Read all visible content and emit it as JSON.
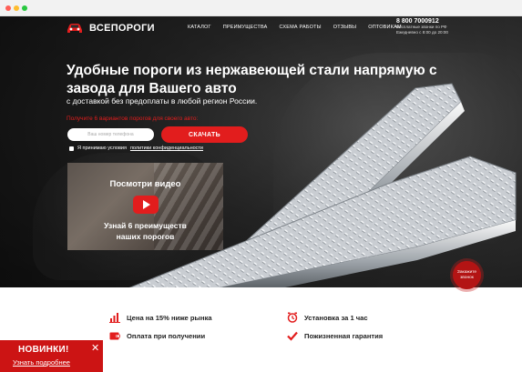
{
  "header": {
    "logo_text": "ВСЕПОРОГИ",
    "nav": [
      "КАТАЛОГ",
      "ПРЕИМУЩЕСТВА",
      "СХЕМА РАБОТЫ",
      "ОТЗЫВЫ",
      "ОПТОВИКАМ"
    ],
    "phone": "8 800 7000912",
    "phone_note": "Бесплатные звонки по РФ",
    "hours": "Ежедневно с 8:00 до 20:00"
  },
  "hero": {
    "title": "Удобные пороги из нержавеющей стали напрямую с завода для Вашего авто",
    "subtitle": "с доставкой без предоплаты в любой регион России.",
    "offer": "Получите 6 вариантов порогов для своего авто:",
    "phone_placeholder": "Ваш номер телефона",
    "cta_label": "СКАЧАТЬ",
    "consent_text": "Я принимаю условия",
    "consent_link": "политики конфиденциальности"
  },
  "video": {
    "title": "Посмотри видео",
    "subtitle_line1": "Узнай 6 преимуществ",
    "subtitle_line2": "наших порогов"
  },
  "callback": {
    "line1": "Закажите",
    "line2": "звонок"
  },
  "features": [
    {
      "icon": "chart-icon",
      "label": "Цена на 15% ниже рынка"
    },
    {
      "icon": "clock-icon",
      "label": "Установка за 1 час"
    },
    {
      "icon": "wallet-icon",
      "label": "Оплата при получении"
    },
    {
      "icon": "checkmark-icon",
      "label": "Пожизненная гарантия"
    }
  ],
  "promo": {
    "title": "НОВИНКИ!",
    "link": "Узнать подробнее",
    "close": "✕"
  },
  "colors": {
    "accent": "#e21d1d",
    "dark_bg": "#2c2c2c",
    "text_dark": "#222222"
  }
}
